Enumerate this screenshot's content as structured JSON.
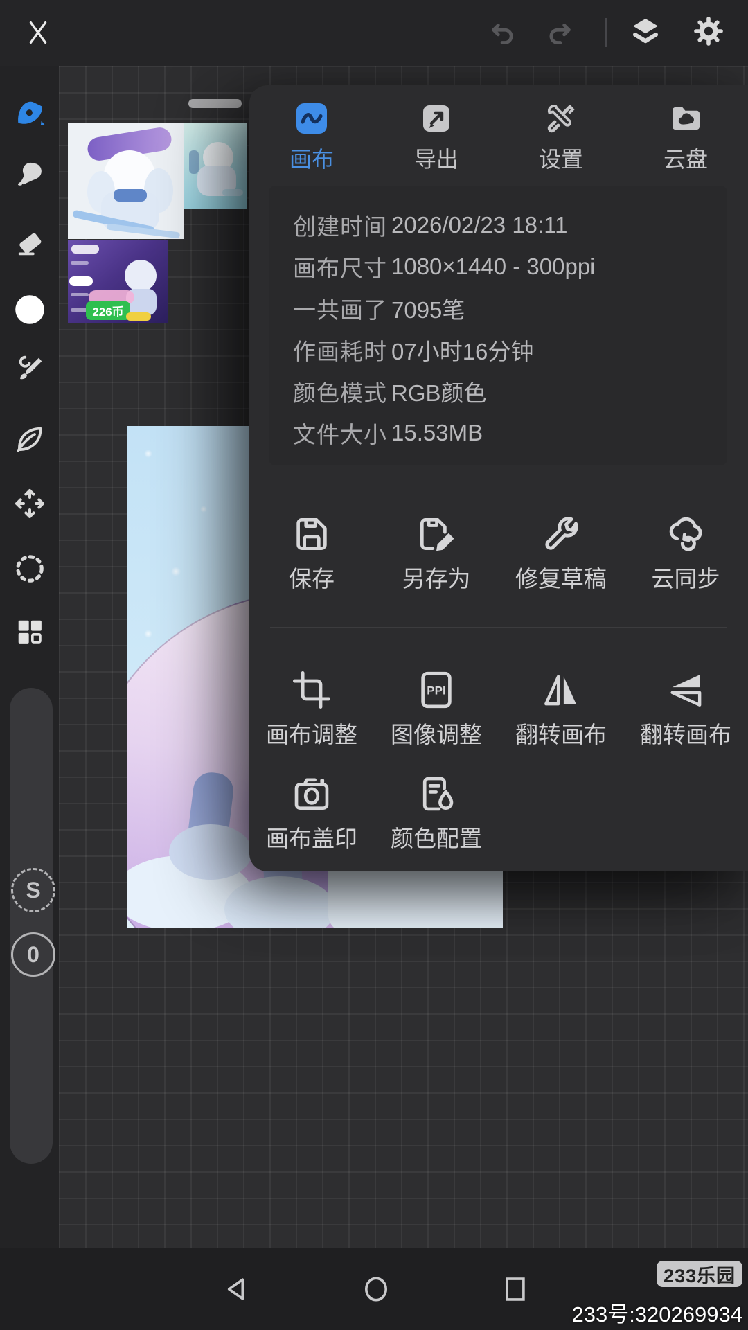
{
  "app": {
    "name": "drawing-app-canvas-settings"
  },
  "colors": {
    "accent_blue": "#4a90e2",
    "tab_icon_blue": "#3e8ce8",
    "panel_bg": "#2c2c2e",
    "canvas_bg": "#2e2e30",
    "toolbar_bg": "#232325",
    "icon_gray": "#d6d6d8",
    "badge_green": "#2fbf4f"
  },
  "icons": {
    "top": [
      "close",
      "undo",
      "redo",
      "layers",
      "gear"
    ],
    "toolbar": [
      "brush-active",
      "smudge",
      "eraser",
      "color-circle",
      "paintbrush",
      "leaf",
      "move",
      "lasso",
      "grid-layout"
    ],
    "nav": [
      "back-triangle",
      "home-circle",
      "recents-square"
    ]
  },
  "panel": {
    "tabs": [
      {
        "label": "画布",
        "active": true
      },
      {
        "label": "导出",
        "active": false
      },
      {
        "label": "设置",
        "active": false
      },
      {
        "label": "云盘",
        "active": false
      }
    ],
    "info_rows": [
      {
        "label": "创建时间",
        "value": "2026/02/23 18:11"
      },
      {
        "label": "画布尺寸",
        "value": "1080×1440 - 300ppi"
      },
      {
        "label": "一共画了",
        "value": "7095笔"
      },
      {
        "label": "作画耗时",
        "value": "07小时16分钟"
      },
      {
        "label": "颜色模式",
        "value": "RGB颜色"
      },
      {
        "label": "文件大小",
        "value": "15.53MB"
      }
    ],
    "actions_row1": [
      {
        "label": "保存"
      },
      {
        "label": "另存为"
      },
      {
        "label": "修复草稿"
      },
      {
        "label": "云同步"
      }
    ],
    "actions_row2": [
      {
        "label": "画布调整"
      },
      {
        "label": "图像调整"
      },
      {
        "label": "翻转画布"
      },
      {
        "label": "翻转画布"
      }
    ],
    "actions_row3": [
      {
        "label": "画布盖印"
      },
      {
        "label": "颜色配置"
      }
    ],
    "ppi_icon_text": "PPI"
  },
  "toolbar": {
    "side_buttons": [
      {
        "label": "S"
      },
      {
        "label": "0"
      }
    ]
  },
  "canvas": {
    "thumbnail_badge": "226币"
  },
  "bottom_bar": {
    "brand_badge": "233乐园",
    "account_id": "233号:320269934"
  }
}
